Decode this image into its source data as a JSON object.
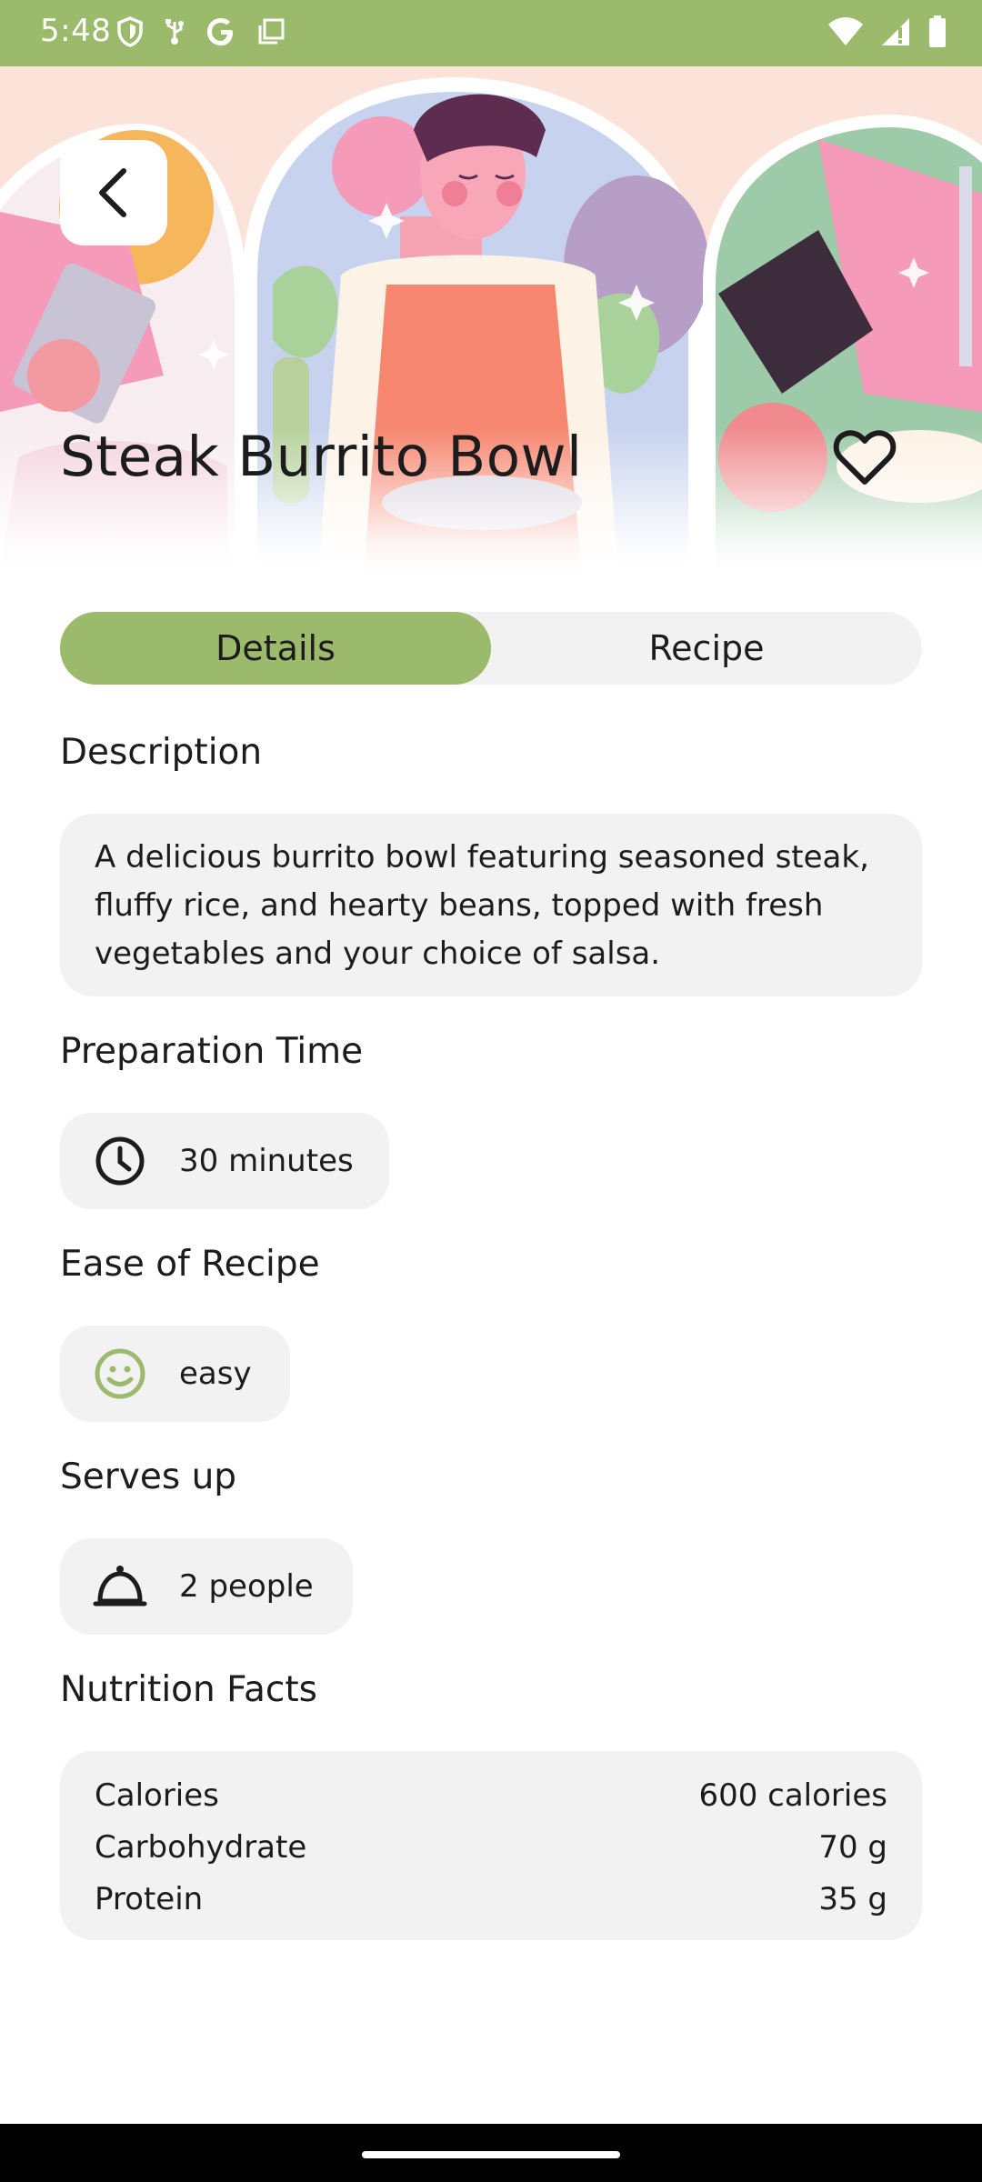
{
  "status_bar": {
    "time": "5:48",
    "background": "#9cba6c",
    "left_icons": [
      "shield-icon",
      "usb-icon",
      "google-icon",
      "copy-icon"
    ],
    "right_icons": [
      "wifi-icon",
      "signal-icon",
      "battery-icon"
    ]
  },
  "header": {
    "title": "Steak Burrito Bowl",
    "back_icon": "chevron-left-icon",
    "favorite_icon": "heart-outline-icon"
  },
  "tabs": [
    {
      "label": "Details",
      "active": true
    },
    {
      "label": "Recipe",
      "active": false
    }
  ],
  "sections": {
    "description": {
      "title": "Description",
      "text": "A delicious burrito bowl featuring seasoned steak, fluffy rice, and hearty beans, topped with fresh vegetables and your choice of salsa."
    },
    "preparation_time": {
      "title": "Preparation Time",
      "value": "30 minutes",
      "icon": "clock-icon"
    },
    "ease": {
      "title": "Ease of Recipe",
      "value": "easy",
      "icon": "smiley-icon"
    },
    "serves": {
      "title": "Serves up",
      "value": "2 people",
      "icon": "cloche-icon"
    },
    "nutrition": {
      "title": "Nutrition Facts",
      "rows": [
        {
          "label": "Calories",
          "value": "600 calories"
        },
        {
          "label": "Carbohydrate",
          "value": "70 g"
        },
        {
          "label": "Protein",
          "value": "35 g"
        }
      ]
    }
  },
  "colors": {
    "accent": "#9cba6c",
    "card_background": "#f2f2f2",
    "text": "#1c1c1c"
  }
}
